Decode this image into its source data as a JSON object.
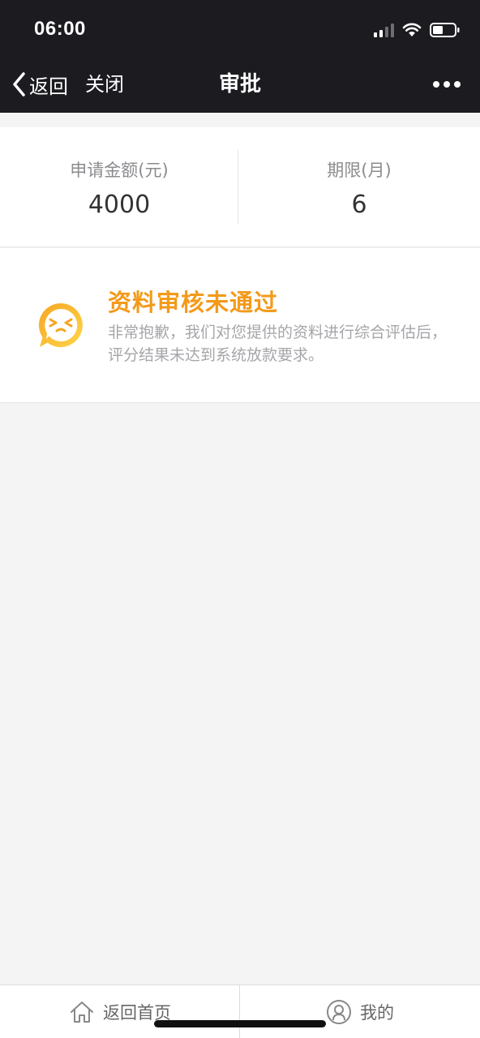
{
  "status_bar": {
    "time": "06:00"
  },
  "nav": {
    "back_label": "返回",
    "close_label": "关闭",
    "title": "审批"
  },
  "summary": {
    "amount_label": "申请金额(元)",
    "amount_value": "4000",
    "term_label": "期限(月)",
    "term_value": "6"
  },
  "result": {
    "title": "资料审核未通过",
    "description": "非常抱歉，我们对您提供的资料进行综合评估后，评分结果未达到系统放款要求。",
    "icon": "sad-face-bubble-icon"
  },
  "tab_bar": {
    "home_label": "返回首页",
    "mine_label": "我的"
  },
  "colors": {
    "nav_background": "#1b1b20",
    "accent_orange": "#f39a1a",
    "page_background": "#f4f4f5"
  }
}
